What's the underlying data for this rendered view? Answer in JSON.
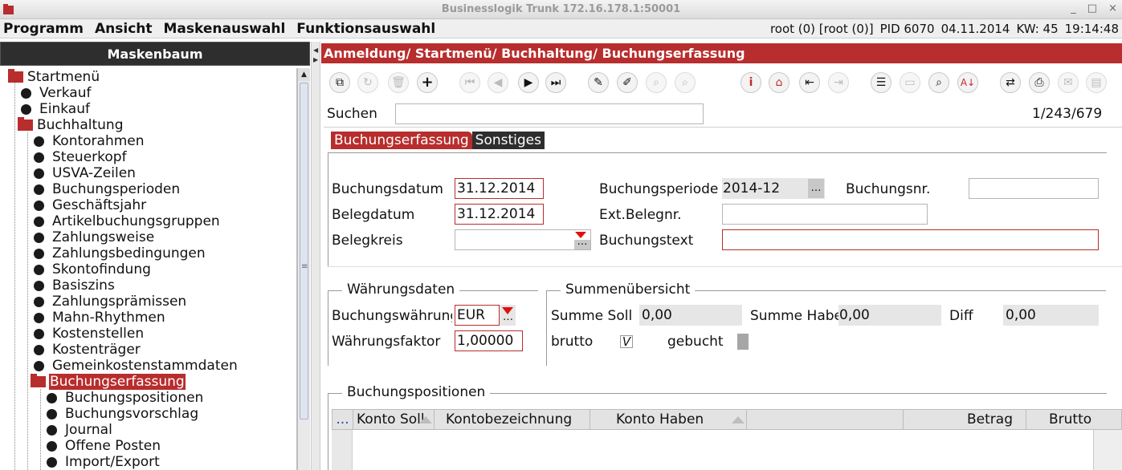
{
  "window": {
    "title": "Businesslogik Trunk 172.16.178.1:50001",
    "app_icon": "app-logo-icon",
    "controls": [
      "_",
      "□",
      "×"
    ]
  },
  "menubar": {
    "items": [
      "Programm",
      "Ansicht",
      "Maskenauswahl",
      "Funktionsauswahl"
    ],
    "status": {
      "user": "root (0) [root (0)]",
      "pid": "PID 6070",
      "date": "04.11.2014",
      "kw": "KW: 45",
      "time": "19:14:48"
    }
  },
  "tree": {
    "header": "Maskenbaum",
    "nodes": [
      {
        "label": "Startmenü",
        "type": "folder"
      },
      {
        "label": "Verkauf",
        "type": "leaf"
      },
      {
        "label": "Einkauf",
        "type": "leaf"
      },
      {
        "label": "Buchhaltung",
        "type": "folder"
      },
      {
        "label": "Kontorahmen",
        "type": "leaf"
      },
      {
        "label": "Steuerkopf",
        "type": "leaf"
      },
      {
        "label": "USVA-Zeilen",
        "type": "leaf"
      },
      {
        "label": "Buchungsperioden",
        "type": "leaf"
      },
      {
        "label": "Geschäftsjahr",
        "type": "leaf"
      },
      {
        "label": "Artikelbuchungsgruppen",
        "type": "leaf"
      },
      {
        "label": "Zahlungsweise",
        "type": "leaf"
      },
      {
        "label": "Zahlungsbedingungen",
        "type": "leaf"
      },
      {
        "label": "Skontofindung",
        "type": "leaf"
      },
      {
        "label": "Basiszins",
        "type": "leaf"
      },
      {
        "label": "Zahlungsprämissen",
        "type": "leaf"
      },
      {
        "label": "Mahn-Rhythmen",
        "type": "leaf"
      },
      {
        "label": "Kostenstellen",
        "type": "leaf"
      },
      {
        "label": "Kostenträger",
        "type": "leaf"
      },
      {
        "label": "Gemeinkostenstammdaten",
        "type": "leaf"
      },
      {
        "label": "Buchungserfassung",
        "type": "folder",
        "selected": true
      },
      {
        "label": "Buchungspositionen",
        "type": "leaf"
      },
      {
        "label": "Buchungsvorschlag",
        "type": "leaf"
      },
      {
        "label": "Journal",
        "type": "leaf"
      },
      {
        "label": "Offene Posten",
        "type": "leaf"
      },
      {
        "label": "Import/Export",
        "type": "leaf"
      }
    ]
  },
  "main": {
    "breadcrumb": "Anmeldung/ Startmenü/ Buchhaltung/ Buchungserfassung",
    "toolbar_icons": [
      "copy-icon",
      "refresh-icon",
      "delete-icon",
      "add-icon",
      "first-record-icon",
      "previous-record-icon",
      "next-record-icon",
      "last-record-icon",
      "edit-icon",
      "edit-pick-icon",
      "search-edit-icon",
      "search-edit-2-icon",
      "info-icon",
      "home-icon",
      "import-icon",
      "export-icon",
      "list-icon",
      "window-icon",
      "search-icon",
      "sort-icon",
      "swap-icon",
      "print-icon",
      "document-icon",
      "report-icon"
    ],
    "search": {
      "label": "Suchen",
      "value": "",
      "counter": "1/243/679"
    },
    "tabs": [
      "Buchungserfassung",
      "Sonstiges"
    ],
    "form": {
      "buchungsdatum_label": "Buchungsdatum",
      "buchungsdatum": "31.12.2014",
      "belegdatum_label": "Belegdatum",
      "belegdatum": "31.12.2014",
      "belegkreis_label": "Belegkreis",
      "belegkreis": "",
      "buchungsperiode_label": "Buchungsperiode",
      "buchungsperiode": "2014-12",
      "ext_belegnr_label": "Ext.Belegnr.",
      "ext_belegnr": "",
      "buchungstext_label": "Buchungstext",
      "buchungstext": "",
      "buchungsnr_label": "Buchungsnr.",
      "buchungsnr": ""
    },
    "waehrung": {
      "title": "Währungsdaten",
      "waehrung_label": "Buchungswährung",
      "waehrung": "EUR",
      "faktor_label": "Währungsfaktor",
      "faktor": "1,00000"
    },
    "summen": {
      "title": "Summenübersicht",
      "soll_label": "Summe Soll",
      "soll": "0,00",
      "haben_label": "Summe Haben",
      "haben": "0,00",
      "diff_label": "Diff",
      "diff": "0,00",
      "brutto_label": "brutto",
      "brutto_checked": "V",
      "gebucht_label": "gebucht"
    },
    "positionen": {
      "title": "Buchungspositionen",
      "row_header_button": "...",
      "columns": [
        "Konto Soll",
        "Kontobezeichnung",
        "Konto Haben",
        "",
        "Betrag",
        "Brutto"
      ]
    }
  },
  "colors": {
    "accent": "#b82d2d",
    "dark": "#2e2e2e"
  }
}
